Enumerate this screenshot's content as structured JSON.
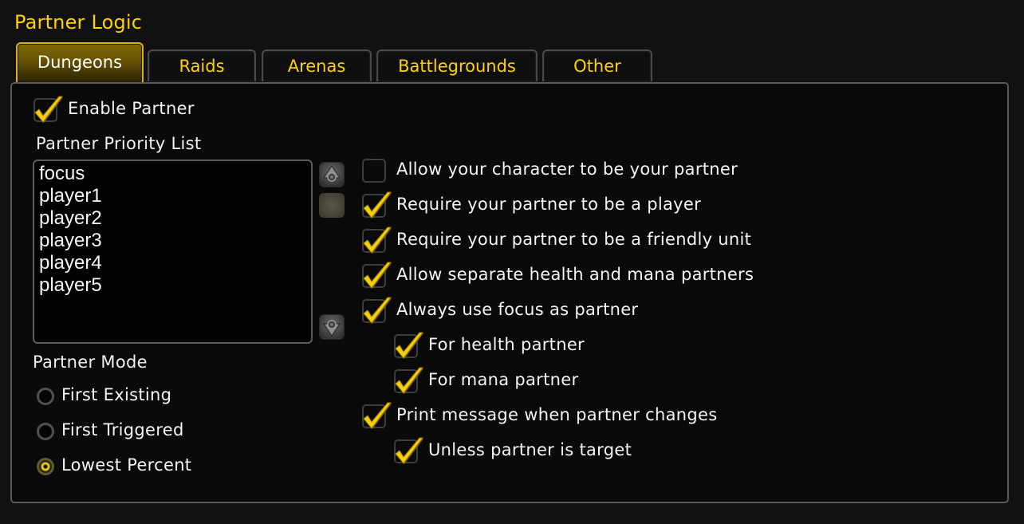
{
  "window": {
    "title": "Partner Logic"
  },
  "tabs": [
    {
      "label": "Dungeons",
      "active": true
    },
    {
      "label": "Raids",
      "active": false
    },
    {
      "label": "Arenas",
      "active": false
    },
    {
      "label": "Battlegrounds",
      "active": false
    },
    {
      "label": "Other",
      "active": false
    }
  ],
  "enable_partner": {
    "label": "Enable Partner",
    "checked": true
  },
  "priority_list": {
    "label": "Partner Priority List",
    "items": [
      "focus",
      "player1",
      "player2",
      "player3",
      "player4",
      "player5"
    ]
  },
  "scrollbar": {
    "up_icon": "arrow-up-icon",
    "down_icon": "arrow-down-icon",
    "position": 0
  },
  "partner_mode": {
    "label": "Partner Mode",
    "options": [
      {
        "label": "First Existing",
        "selected": false
      },
      {
        "label": "First Triggered",
        "selected": false
      },
      {
        "label": "Lowest Percent",
        "selected": true
      }
    ]
  },
  "options": [
    {
      "label": "Allow your character to be your partner",
      "checked": false,
      "indent": 0
    },
    {
      "label": "Require your partner to be a player",
      "checked": true,
      "indent": 0
    },
    {
      "label": "Require your partner to be a friendly unit",
      "checked": true,
      "indent": 0
    },
    {
      "label": "Allow separate health and mana partners",
      "checked": true,
      "indent": 0
    },
    {
      "label": "Always use focus as partner",
      "checked": true,
      "indent": 0
    },
    {
      "label": "For health partner",
      "checked": true,
      "indent": 1
    },
    {
      "label": "For mana partner",
      "checked": true,
      "indent": 1
    },
    {
      "label": "Print message when partner changes",
      "checked": true,
      "indent": 0
    },
    {
      "label": "Unless partner is target",
      "checked": true,
      "indent": 1
    }
  ],
  "colors": {
    "accent": "#ffd100",
    "check": "#f2d10a",
    "text": "#f4f4f4"
  }
}
